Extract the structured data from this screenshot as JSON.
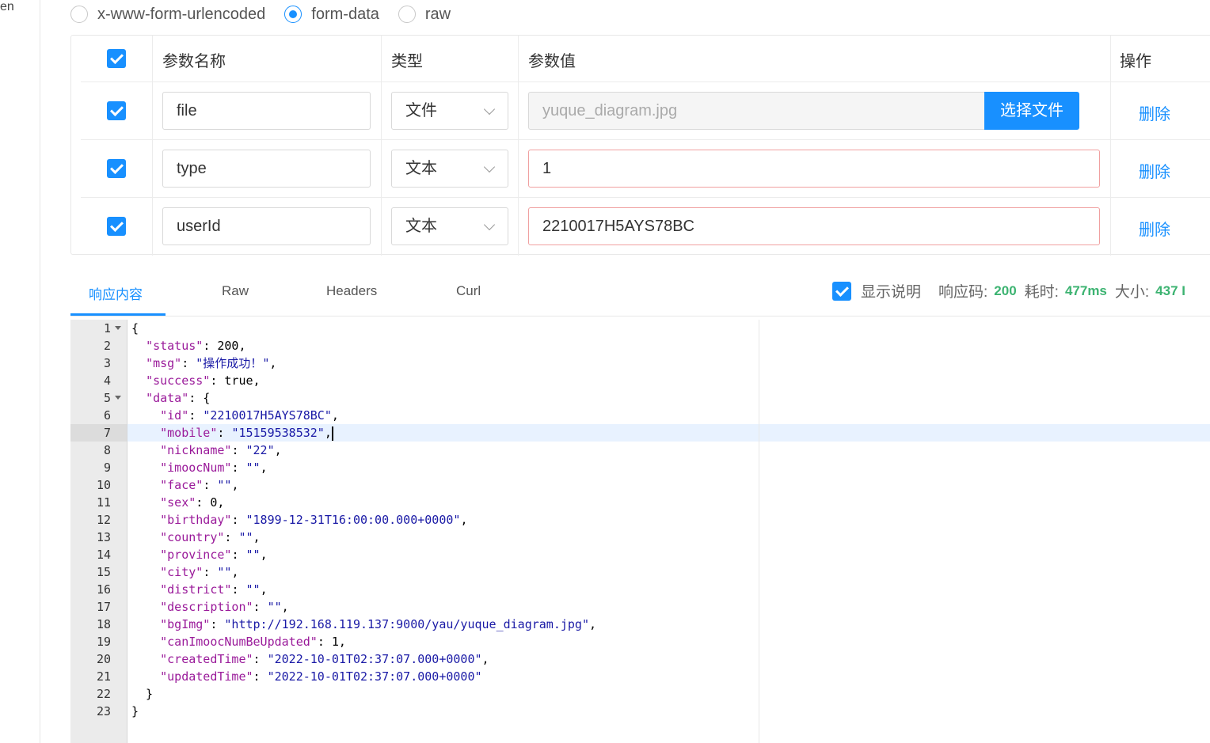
{
  "left_edge_text": "en",
  "body_types": [
    {
      "label": "x-www-form-urlencoded",
      "selected": false
    },
    {
      "label": "form-data",
      "selected": true
    },
    {
      "label": "raw",
      "selected": false
    }
  ],
  "params_table": {
    "headers": {
      "name": "参数名称",
      "type": "类型",
      "value": "参数值",
      "action": "操作"
    },
    "rows": [
      {
        "name": "file",
        "type": "文件",
        "value": "yuque_diagram.jpg",
        "button": "选择文件",
        "action": "删除"
      },
      {
        "name": "type",
        "type": "文本",
        "value": "1",
        "action": "删除"
      },
      {
        "name": "userId",
        "type": "文本",
        "value": "2210017H5AYS78BC",
        "action": "删除"
      }
    ]
  },
  "response_tabs": [
    "响应内容",
    "Raw",
    "Headers",
    "Curl"
  ],
  "response_stats": {
    "show_desc_label": "显示说明",
    "code_label": "响应码:",
    "code_value": "200",
    "time_label": "耗时:",
    "time_value": "477ms",
    "size_label": "大小:",
    "size_value": "437 I"
  },
  "code_lines": [
    "{",
    "  \"status\": 200,",
    "  \"msg\": \"操作成功！\",",
    "  \"success\": true,",
    "  \"data\": {",
    "    \"id\": \"2210017H5AYS78BC\",",
    "    \"mobile\": \"15159538532\",",
    "    \"nickname\": \"22\",",
    "    \"imoocNum\": \"\",",
    "    \"face\": \"\",",
    "    \"sex\": 0,",
    "    \"birthday\": \"1899-12-31T16:00:00.000+0000\",",
    "    \"country\": \"\",",
    "    \"province\": \"\",",
    "    \"city\": \"\",",
    "    \"district\": \"\",",
    "    \"description\": \"\",",
    "    \"bgImg\": \"http://192.168.119.137:9000/yau/yuque_diagram.jpg\",",
    "    \"canImoocNumBeUpdated\": 1,",
    "    \"createdTime\": \"2022-10-01T02:37:07.000+0000\",",
    "    \"updatedTime\": \"2022-10-01T02:37:07.000+0000\"",
    "  }",
    "}"
  ]
}
